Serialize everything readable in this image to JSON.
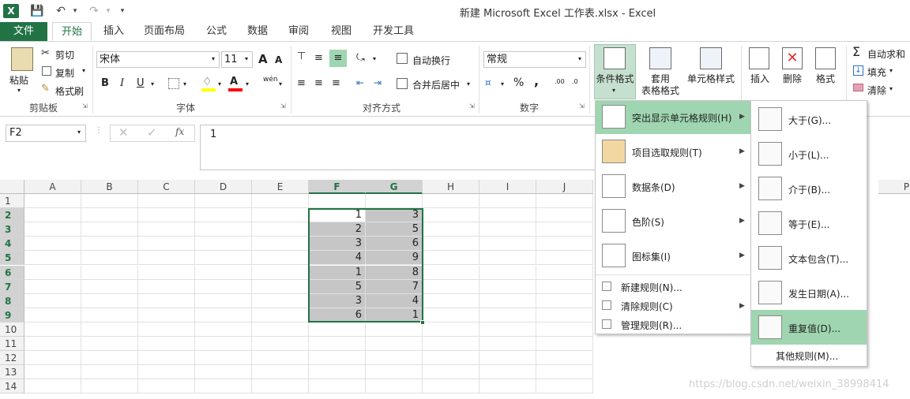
{
  "titlebar": {
    "app_icon": "X",
    "title": "新建 Microsoft Excel 工作表.xlsx - Excel"
  },
  "tabs": {
    "file": "文件",
    "home": "开始",
    "insert": "插入",
    "page_layout": "页面布局",
    "formulas": "公式",
    "data": "数据",
    "review": "审阅",
    "view": "视图",
    "developer": "开发工具"
  },
  "clipboard": {
    "paste": "粘贴",
    "cut": "剪切",
    "copy": "复制",
    "format_painter": "格式刷",
    "label": "剪贴板"
  },
  "font": {
    "name": "宋体",
    "size": "11",
    "label": "字体",
    "bold": "B",
    "italic": "I",
    "underline": "U",
    "grow": "A",
    "shrink": "A",
    "phonetic": "wén"
  },
  "alignment": {
    "wrap": "自动换行",
    "merge": "合并后居中",
    "label": "对齐方式"
  },
  "number": {
    "format": "常规",
    "percent": "%",
    "comma": ",",
    "label": "数字"
  },
  "styles": {
    "conditional": "条件格式",
    "table_format": "套用\n表格格式",
    "cell_styles": "单元格样式"
  },
  "cells": {
    "insert": "插入",
    "delete": "删除",
    "format": "格式"
  },
  "editing": {
    "autosum": "自动求和",
    "fill": "填充",
    "clear": "清除"
  },
  "formula": {
    "namebox": "F2",
    "value": "1",
    "fx": "fx"
  },
  "columns": [
    "A",
    "B",
    "C",
    "D",
    "E",
    "F",
    "G",
    "H",
    "I",
    "J",
    "P"
  ],
  "rows": [
    "1",
    "2",
    "3",
    "4",
    "5",
    "6",
    "7",
    "8",
    "9",
    "10",
    "11",
    "12",
    "13",
    "14"
  ],
  "cells_data": {
    "F": [
      "1",
      "2",
      "3",
      "4",
      "1",
      "5",
      "3",
      "6"
    ],
    "G": [
      "3",
      "5",
      "6",
      "9",
      "8",
      "7",
      "4",
      "1"
    ]
  },
  "menu1": {
    "items": [
      "突出显示单元格规则(H)",
      "项目选取规则(T)",
      "数据条(D)",
      "色阶(S)",
      "图标集(I)"
    ],
    "small_items": [
      "新建规则(N)...",
      "清除规则(C)",
      "管理规则(R)..."
    ]
  },
  "menu2": {
    "items": [
      "大于(G)...",
      "小于(L)...",
      "介于(B)...",
      "等于(E)...",
      "文本包含(T)...",
      "发生日期(A)...",
      "重复值(D)..."
    ],
    "more": "其他规则(M)..."
  },
  "watermark": "https://blog.csdn.net/weixin_38998414"
}
